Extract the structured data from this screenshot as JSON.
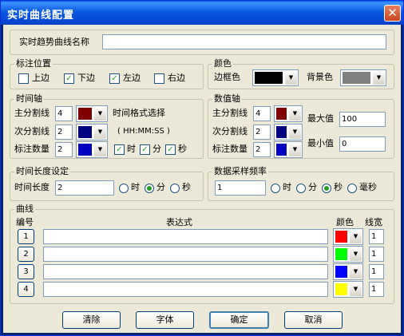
{
  "window": {
    "title": "实时曲线配置",
    "close_symbol": "✕"
  },
  "name_row": {
    "label": "实时趋势曲线名称",
    "value": ""
  },
  "label_position": {
    "title": "标注位置",
    "options": [
      {
        "label": "上边",
        "checked": false
      },
      {
        "label": "下边",
        "checked": true
      },
      {
        "label": "左边",
        "checked": true
      },
      {
        "label": "右边",
        "checked": false
      }
    ]
  },
  "colors": {
    "title": "颜色",
    "border_label": "边框色",
    "border_color": "#000000",
    "bg_label": "背景色",
    "bg_color": "#808080"
  },
  "time_axis": {
    "title": "时间轴",
    "major_label": "主分割线",
    "major_value": "4",
    "major_color": "#800000",
    "minor_label": "次分割线",
    "minor_value": "2",
    "minor_color": "#000080",
    "count_label": "标注数量",
    "count_value": "2",
    "count_color": "#0000c0",
    "format_label": "时间格式选择",
    "format_text": "( HH:MM:SS )",
    "format_options": [
      {
        "label": "时",
        "checked": true
      },
      {
        "label": "分",
        "checked": true
      },
      {
        "label": "秒",
        "checked": true
      }
    ]
  },
  "value_axis": {
    "title": "数值轴",
    "major_label": "主分割线",
    "major_value": "4",
    "major_color": "#800000",
    "minor_label": "次分割线",
    "minor_value": "2",
    "minor_color": "#000080",
    "count_label": "标注数量",
    "count_value": "2",
    "count_color": "#0000c0",
    "max_label": "最大值",
    "max_value": "100",
    "min_label": "最小值",
    "min_value": "0"
  },
  "time_length": {
    "title": "时间长度设定",
    "label": "时间长度",
    "value": "2",
    "units": [
      {
        "label": "时",
        "selected": false
      },
      {
        "label": "分",
        "selected": true
      },
      {
        "label": "秒",
        "selected": false
      }
    ]
  },
  "sampling": {
    "title": "数据采样频率",
    "value": "1",
    "units": [
      {
        "label": "时",
        "selected": false
      },
      {
        "label": "分",
        "selected": false
      },
      {
        "label": "秒",
        "selected": true
      },
      {
        "label": "毫秒",
        "selected": false
      }
    ]
  },
  "curves": {
    "title": "曲线",
    "col_num": "编号",
    "col_expr": "表达式",
    "col_color": "颜色",
    "col_width": "线宽",
    "rows": [
      {
        "num": "1",
        "expr": "",
        "color": "#ff0000",
        "width": "1"
      },
      {
        "num": "2",
        "expr": "",
        "color": "#00ff00",
        "width": "1"
      },
      {
        "num": "3",
        "expr": "",
        "color": "#0000ff",
        "width": "1"
      },
      {
        "num": "4",
        "expr": "",
        "color": "#ffff00",
        "width": "1"
      }
    ]
  },
  "buttons": {
    "clear": "清除",
    "font": "字体",
    "ok": "确定",
    "cancel": "取消"
  }
}
